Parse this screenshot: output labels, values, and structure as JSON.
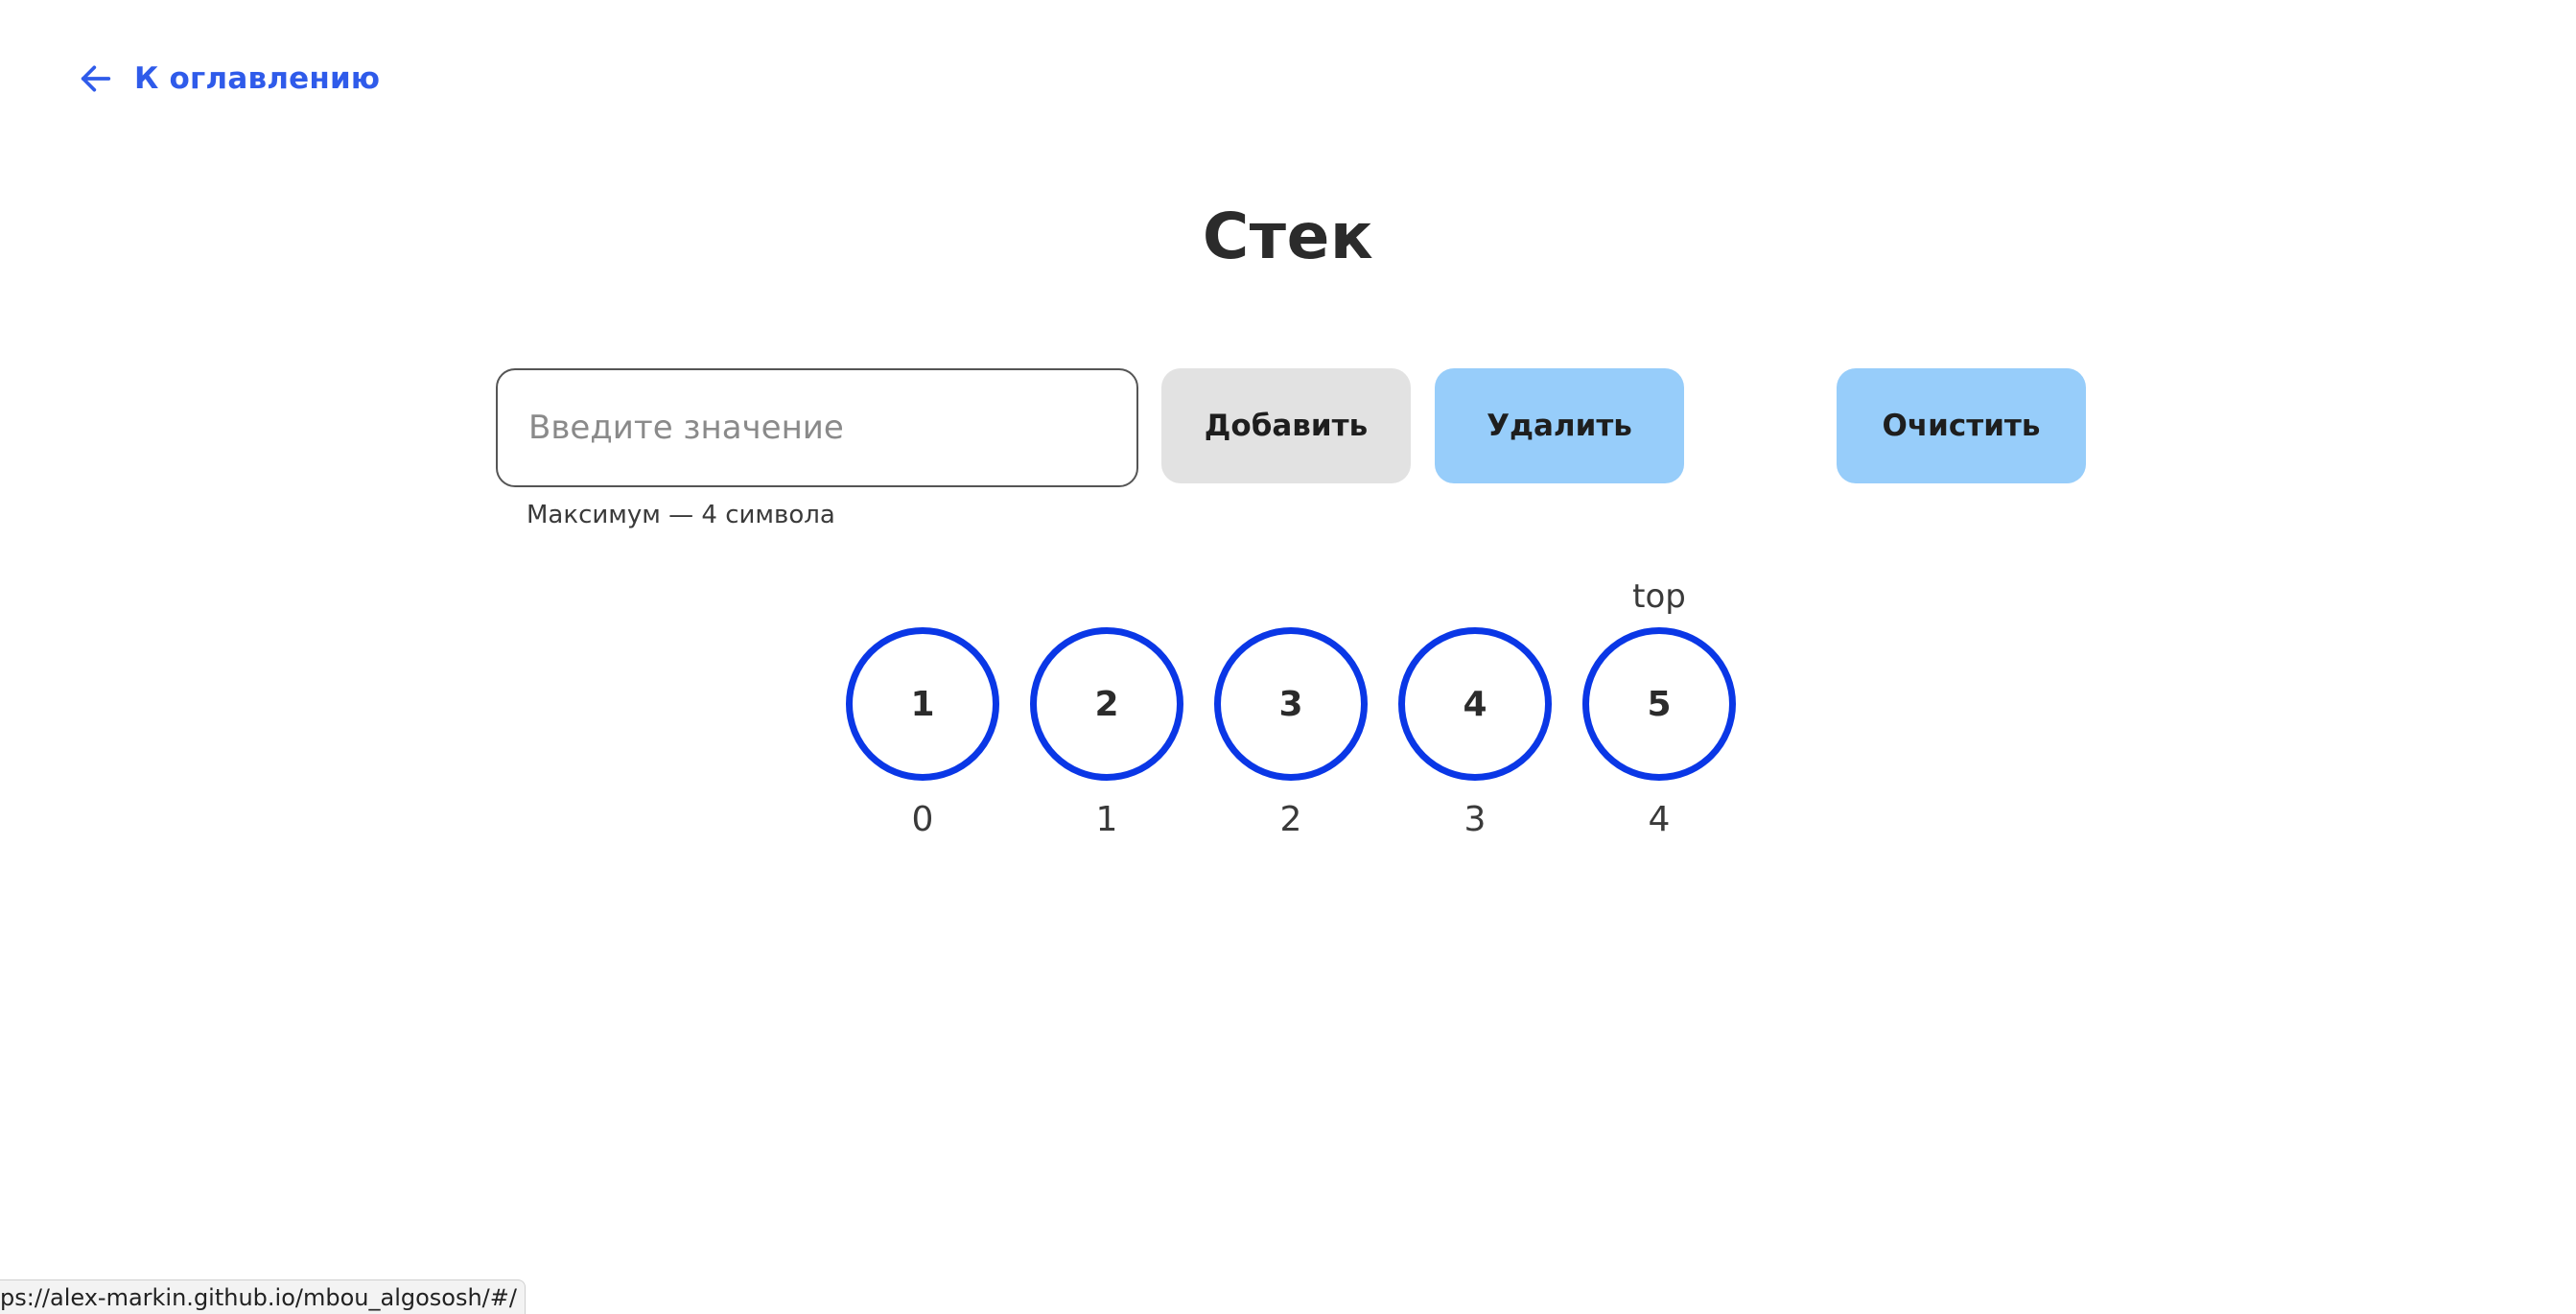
{
  "nav": {
    "back_label": "К оглавлению"
  },
  "page": {
    "title": "Стек"
  },
  "form": {
    "input_placeholder": "Введите значение",
    "input_value": "",
    "hint": "Максимум — 4 символа",
    "add_label": "Добавить",
    "remove_label": "Удалить",
    "clear_label": "Очистить"
  },
  "stack": {
    "top_label": "top",
    "items": [
      {
        "value": "1",
        "index": "0"
      },
      {
        "value": "2",
        "index": "1"
      },
      {
        "value": "3",
        "index": "2"
      },
      {
        "value": "4",
        "index": "3"
      },
      {
        "value": "5",
        "index": "4"
      }
    ]
  },
  "status_bar": {
    "url": "ps://alex-markin.github.io/mbou_algososh/#/"
  },
  "colors": {
    "link": "#2f5bea",
    "circle_border": "#0a37e6",
    "button_primary": "#97cdfa",
    "button_disabled": "#e2e2e2"
  }
}
